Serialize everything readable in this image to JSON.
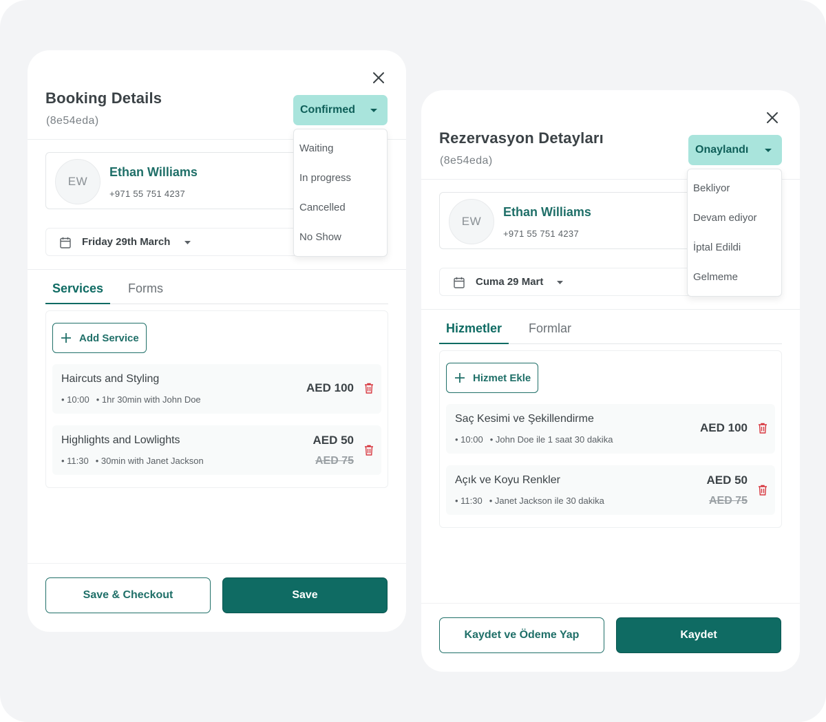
{
  "colors": {
    "accent": "#0f6b63",
    "status_bg": "#a9e4dc",
    "delete": "#d7373f"
  },
  "en": {
    "title": "Booking Details",
    "booking_id": "(8e54eda)",
    "status": "Confirmed",
    "status_options": [
      "Waiting",
      "In progress",
      "Cancelled",
      "No Show"
    ],
    "client": {
      "initials": "EW",
      "name": "Ethan Williams",
      "phone": "+971 55 751 4237"
    },
    "date": "Friday 29th March",
    "tabs": [
      "Services",
      "Forms"
    ],
    "add_service": "Add Service",
    "services": [
      {
        "name": "Haircuts and Styling",
        "time": "• 10:00",
        "detail": "• 1hr 30min with John Doe",
        "price": "AED 100",
        "old_price": ""
      },
      {
        "name": "Highlights and Lowlights",
        "time": "• 11:30",
        "detail": "• 30min with Janet Jackson",
        "price": "AED 50",
        "old_price": "AED 75"
      }
    ],
    "save_checkout": "Save & Checkout",
    "save": "Save"
  },
  "tr": {
    "title": "Rezervasyon Detayları",
    "booking_id": "(8e54eda)",
    "status": "Onaylandı",
    "status_options": [
      "Bekliyor",
      "Devam ediyor",
      "İptal Edildi",
      "Gelmeme"
    ],
    "client": {
      "initials": "EW",
      "name": "Ethan Williams",
      "phone": "+971 55 751 4237"
    },
    "date": "Cuma 29 Mart",
    "tabs": [
      "Hizmetler",
      "Formlar"
    ],
    "add_service": "Hizmet Ekle",
    "services": [
      {
        "name": "Saç Kesimi ve Şekillendirme",
        "time": "• 10:00",
        "detail": "• John Doe ile 1 saat 30 dakika",
        "price": "AED 100",
        "old_price": ""
      },
      {
        "name": "Açık ve Koyu Renkler",
        "time": "• 11:30",
        "detail": "• Janet Jackson ile 30 dakika",
        "price": "AED 50",
        "old_price": "AED 75"
      }
    ],
    "save_checkout": "Kaydet ve Ödeme Yap",
    "save": "Kaydet"
  }
}
